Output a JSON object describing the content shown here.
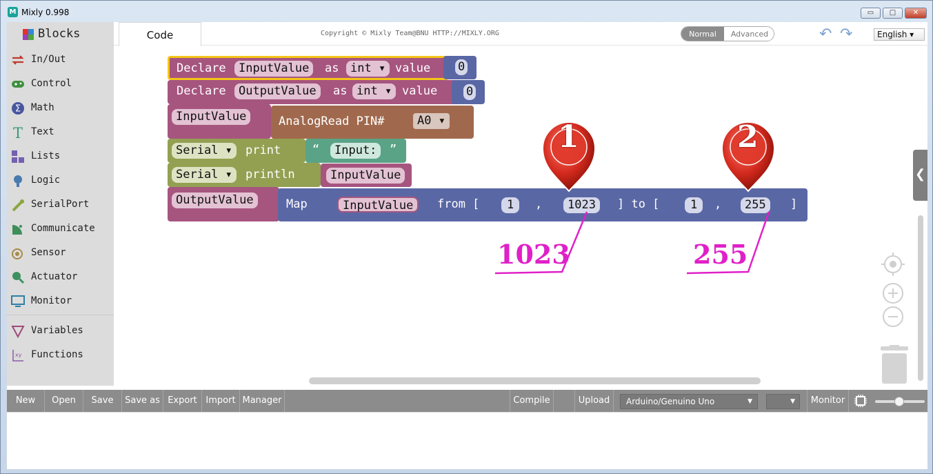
{
  "window": {
    "title": "Mixly 0.998",
    "min_label": "▭",
    "max_label": "□",
    "close_label": "✕"
  },
  "sidebar": {
    "header": "Blocks",
    "items": [
      {
        "label": "In/Out",
        "icon": "in-out-icon"
      },
      {
        "label": "Control",
        "icon": "gamepad-icon"
      },
      {
        "label": "Math",
        "icon": "math-icon"
      },
      {
        "label": "Text",
        "icon": "text-icon"
      },
      {
        "label": "Lists",
        "icon": "lists-icon"
      },
      {
        "label": "Logic",
        "icon": "bulb-icon"
      },
      {
        "label": "SerialPort",
        "icon": "serial-icon"
      },
      {
        "label": "Communicate",
        "icon": "communicate-icon"
      },
      {
        "label": "Sensor",
        "icon": "sensor-icon"
      },
      {
        "label": "Actuator",
        "icon": "actuator-icon"
      },
      {
        "label": "Monitor",
        "icon": "monitor-icon"
      },
      {
        "label": "Variables",
        "icon": "variables-icon"
      },
      {
        "label": "Functions",
        "icon": "functions-icon"
      }
    ]
  },
  "toolbar": {
    "tab": "Code",
    "copyright": "Copyright © Mixly Team@BNU HTTP://MIXLY.ORG",
    "mode_normal": "Normal",
    "mode_advanced": "Advanced",
    "language": "English ▾"
  },
  "blocks": {
    "declare1": {
      "kw": "Declare",
      "name": "InputValue",
      "as": "as",
      "type": "int ▾",
      "value": "value",
      "num": "0"
    },
    "declare2": {
      "kw": "Declare",
      "name": "OutputValue",
      "as": "as",
      "type": "int ▾",
      "value": "value",
      "num": "0"
    },
    "assign1": {
      "var": "InputValue",
      "fn": "AnalogRead PIN#",
      "pin": "A0 ▾"
    },
    "print": {
      "obj": "Serial ▾",
      "fn": "print",
      "open_quote": "“",
      "text": "Input:",
      "close_quote": "”"
    },
    "println": {
      "obj": "Serial ▾",
      "fn": "println",
      "arg": "InputValue"
    },
    "map": {
      "var": "OutputValue",
      "fn": "Map",
      "arg": "InputValue",
      "from": "from [",
      "from_low": "1",
      "comma": ",",
      "from_high": "1023",
      "to": "] to [",
      "to_low": "1",
      "to_high": "255",
      "close": "]"
    }
  },
  "annotations": {
    "marker1": "1",
    "marker2": "2",
    "label1": "1023",
    "label2": "255"
  },
  "controls": {
    "collapse": "❮"
  },
  "bottom": {
    "new": "New",
    "open": "Open",
    "save": "Save",
    "save_as": "Save as",
    "export": "Export",
    "import": "Import",
    "manager": "Manager",
    "compile": "Compile",
    "upload": "Upload",
    "board": "Arduino/Genuino Uno",
    "port_arrow": "▼",
    "monitor": "Monitor"
  },
  "colors": {
    "procedure": "#a6557f",
    "variable": "#5a67a5",
    "io": "#a0694d",
    "serial": "#93a052",
    "text": "#5aa387",
    "annotation": "#e020c8",
    "marker": "#d42a1e"
  }
}
